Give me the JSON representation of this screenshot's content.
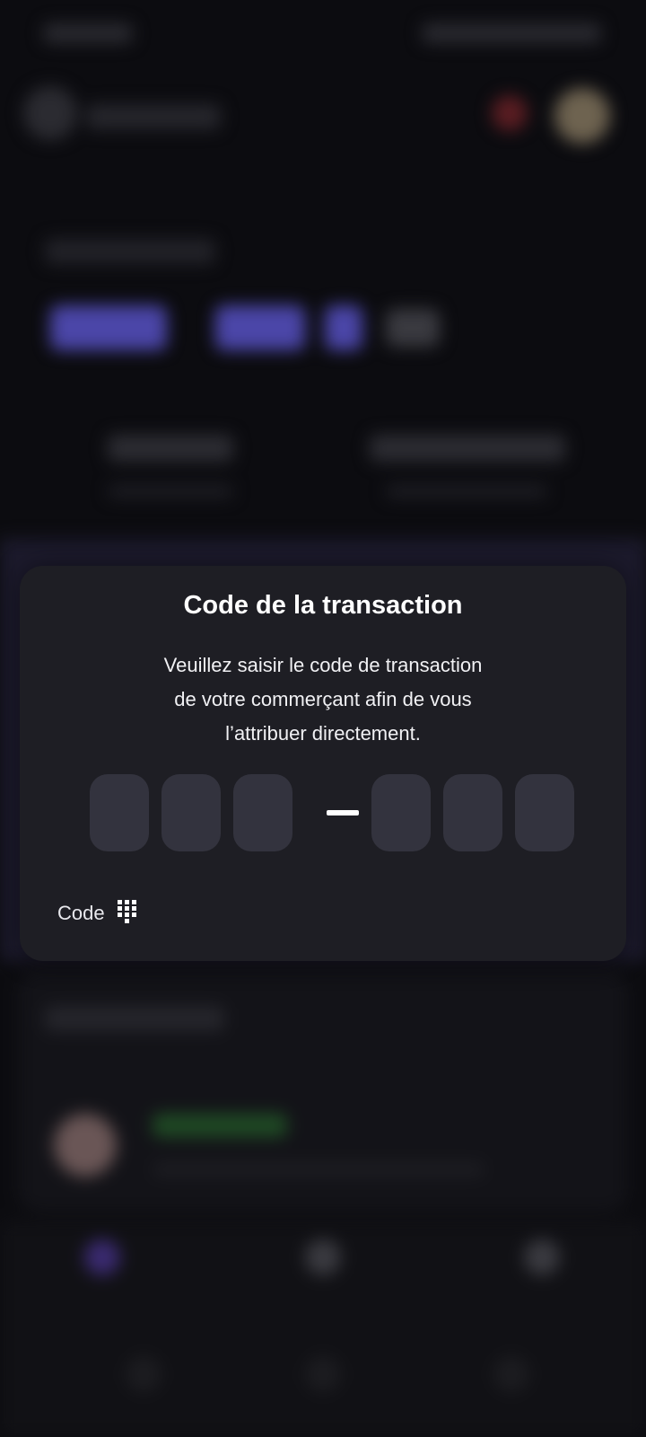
{
  "modal": {
    "title": "Code de la transaction",
    "description_lines": [
      "Veuillez saisir le code de transaction",
      "de votre commerçant afin de vous",
      "l’attribuer directement."
    ],
    "code_slots": [
      {
        "group": 1,
        "value": ""
      },
      {
        "group": 1,
        "value": ""
      },
      {
        "group": 1,
        "value": ""
      },
      {
        "group": 2,
        "value": ""
      },
      {
        "group": 2,
        "value": ""
      },
      {
        "group": 2,
        "value": ""
      }
    ],
    "input_mode_toggle": {
      "label": "Code",
      "icon": "dialpad-icon"
    }
  },
  "colors": {
    "modal_background": "#1e1e24",
    "code_slot_background": "#33333e",
    "backdrop": "#0c0c10",
    "accent_purple": "#4b46a8"
  }
}
